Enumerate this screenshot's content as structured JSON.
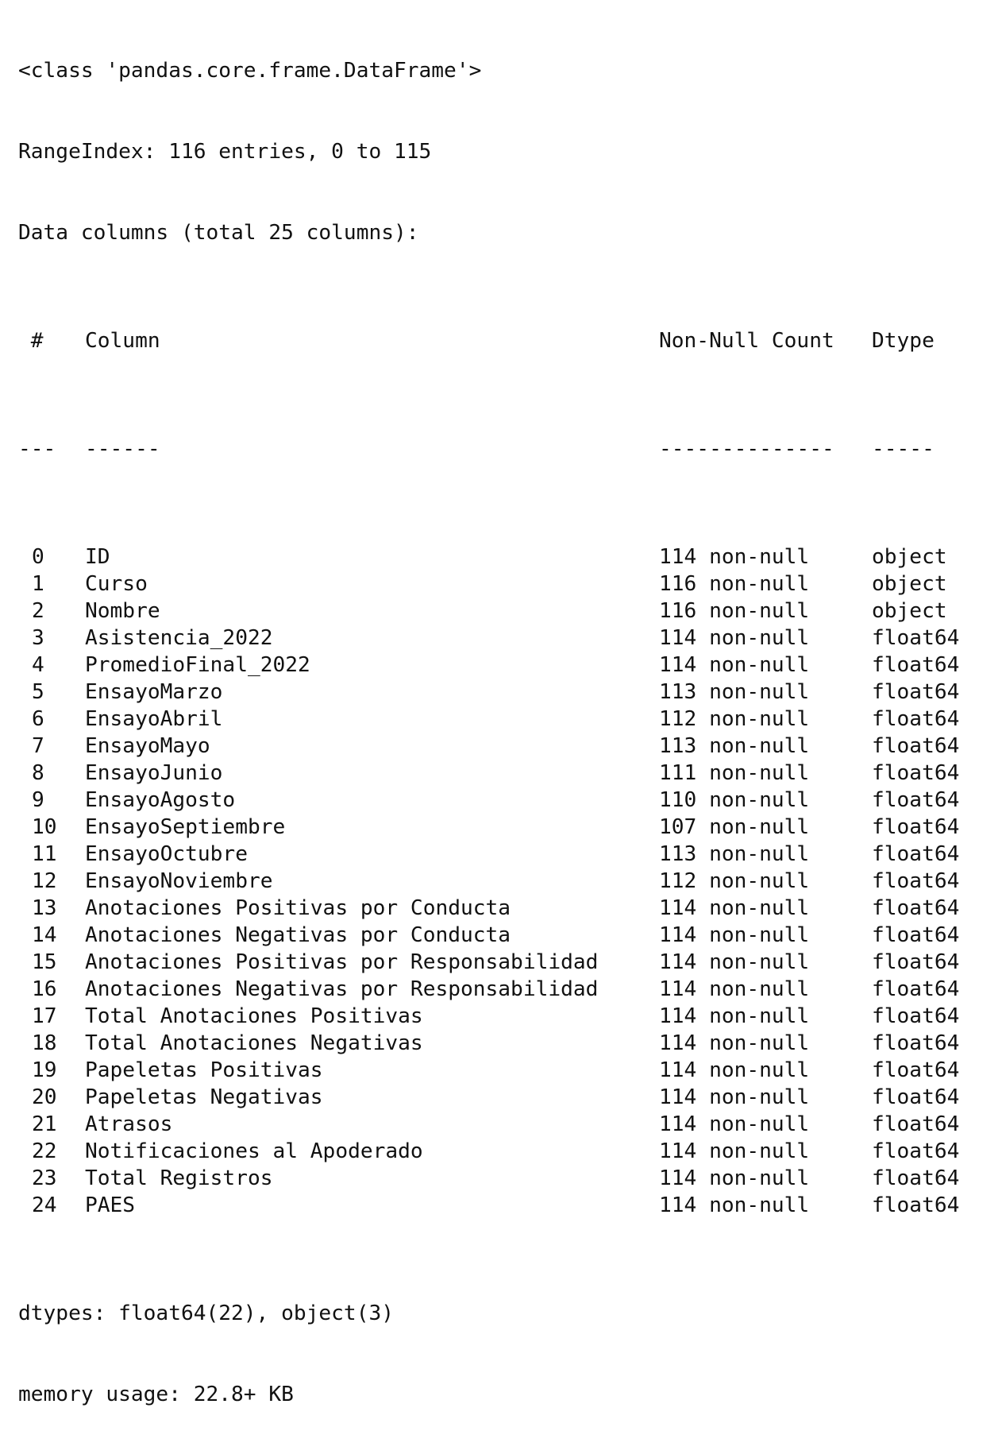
{
  "header_lines": [
    "<class 'pandas.core.frame.DataFrame'>",
    "RangeIndex: 116 entries, 0 to 115",
    "Data columns (total 25 columns):"
  ],
  "table_header": {
    "num": " #",
    "column": "Column",
    "count": "Non-Null Count",
    "dtype": "Dtype"
  },
  "separator": {
    "num": "---",
    "column": "------",
    "count": "--------------",
    "dtype": "-----"
  },
  "rows": [
    {
      "num": "0",
      "column": "ID",
      "count": "114 non-null",
      "dtype": "object"
    },
    {
      "num": "1",
      "column": "Curso",
      "count": "116 non-null",
      "dtype": "object"
    },
    {
      "num": "2",
      "column": "Nombre",
      "count": "116 non-null",
      "dtype": "object"
    },
    {
      "num": "3",
      "column": "Asistencia_2022",
      "count": "114 non-null",
      "dtype": "float64"
    },
    {
      "num": "4",
      "column": "PromedioFinal_2022",
      "count": "114 non-null",
      "dtype": "float64"
    },
    {
      "num": "5",
      "column": "EnsayoMarzo",
      "count": "113 non-null",
      "dtype": "float64"
    },
    {
      "num": "6",
      "column": "EnsayoAbril",
      "count": "112 non-null",
      "dtype": "float64"
    },
    {
      "num": "7",
      "column": "EnsayoMayo",
      "count": "113 non-null",
      "dtype": "float64"
    },
    {
      "num": "8",
      "column": "EnsayoJunio",
      "count": "111 non-null",
      "dtype": "float64"
    },
    {
      "num": "9",
      "column": "EnsayoAgosto",
      "count": "110 non-null",
      "dtype": "float64"
    },
    {
      "num": "10",
      "column": "EnsayoSeptiembre",
      "count": "107 non-null",
      "dtype": "float64"
    },
    {
      "num": "11",
      "column": "EnsayoOctubre",
      "count": "113 non-null",
      "dtype": "float64"
    },
    {
      "num": "12",
      "column": "EnsayoNoviembre",
      "count": "112 non-null",
      "dtype": "float64"
    },
    {
      "num": "13",
      "column": "Anotaciones Positivas por Conducta",
      "count": "114 non-null",
      "dtype": "float64"
    },
    {
      "num": "14",
      "column": "Anotaciones Negativas por Conducta",
      "count": "114 non-null",
      "dtype": "float64"
    },
    {
      "num": "15",
      "column": "Anotaciones Positivas por Responsabilidad",
      "count": "114 non-null",
      "dtype": "float64"
    },
    {
      "num": "16",
      "column": "Anotaciones Negativas por Responsabilidad",
      "count": "114 non-null",
      "dtype": "float64"
    },
    {
      "num": "17",
      "column": "Total Anotaciones Positivas",
      "count": "114 non-null",
      "dtype": "float64"
    },
    {
      "num": "18",
      "column": "Total Anotaciones Negativas",
      "count": "114 non-null",
      "dtype": "float64"
    },
    {
      "num": "19",
      "column": "Papeletas Positivas",
      "count": "114 non-null",
      "dtype": "float64"
    },
    {
      "num": "20",
      "column": "Papeletas Negativas",
      "count": "114 non-null",
      "dtype": "float64"
    },
    {
      "num": "21",
      "column": "Atrasos",
      "count": "114 non-null",
      "dtype": "float64"
    },
    {
      "num": "22",
      "column": "Notificaciones al Apoderado",
      "count": "114 non-null",
      "dtype": "float64"
    },
    {
      "num": "23",
      "column": "Total Registros",
      "count": "114 non-null",
      "dtype": "float64"
    },
    {
      "num": "24",
      "column": "PAES",
      "count": "114 non-null",
      "dtype": "float64"
    }
  ],
  "footer_lines": [
    "dtypes: float64(22), object(3)",
    "memory usage: 22.8+ KB"
  ]
}
